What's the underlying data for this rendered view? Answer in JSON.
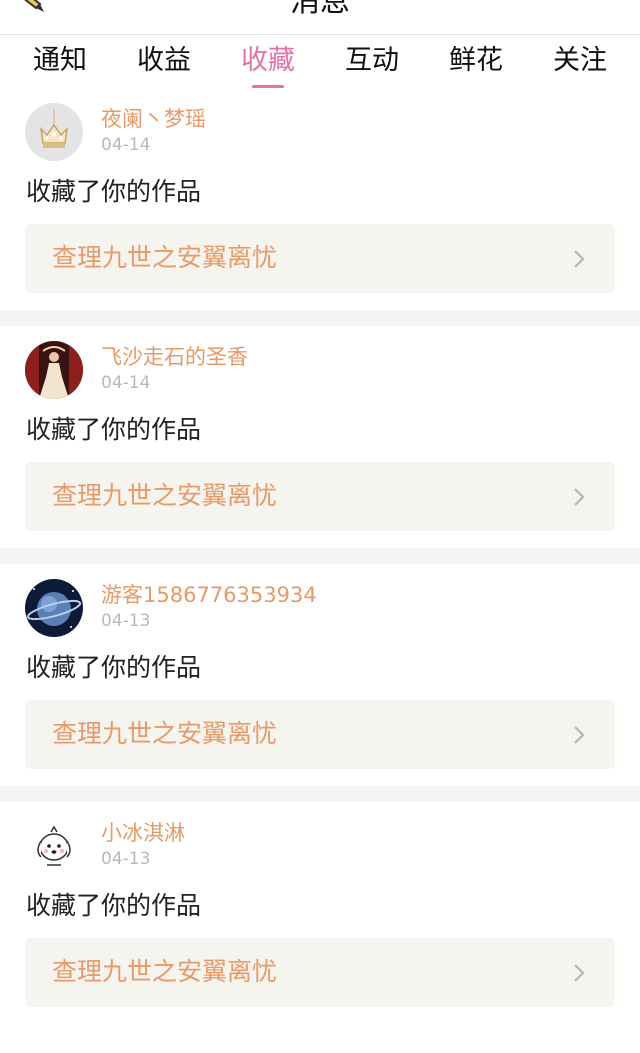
{
  "header": {
    "title": "消息",
    "pen_icon": "pen-icon"
  },
  "tabs": [
    {
      "label": "通知",
      "active": false
    },
    {
      "label": "收益",
      "active": false
    },
    {
      "label": "收藏",
      "active": true
    },
    {
      "label": "互动",
      "active": false
    },
    {
      "label": "鲜花",
      "active": false
    },
    {
      "label": "关注",
      "active": false
    }
  ],
  "colors": {
    "accent": "#e872a8",
    "username": "#e89a6a",
    "date": "#b9b9b9",
    "card_bg": "#f5f4ef",
    "separator": "#f6f4f4"
  },
  "items": [
    {
      "user": "夜阑丶梦瑶",
      "date": "04-14",
      "action": "收藏了你的作品",
      "work": "查理九世之安翼离忧",
      "avatar_icon": "crown-pendant-avatar"
    },
    {
      "user": "飞沙走石的圣香",
      "date": "04-14",
      "action": "收藏了你的作品",
      "work": "查理九世之安翼离忧",
      "avatar_icon": "girl-in-dress-avatar"
    },
    {
      "user": "游客1586776353934",
      "date": "04-13",
      "action": "收藏了你的作品",
      "work": "查理九世之安翼离忧",
      "avatar_icon": "planet-avatar"
    },
    {
      "user": "小冰淇淋",
      "date": "04-13",
      "action": "收藏了你的作品",
      "work": "查理九世之安翼离忧",
      "avatar_icon": "cartoon-dog-avatar"
    }
  ]
}
